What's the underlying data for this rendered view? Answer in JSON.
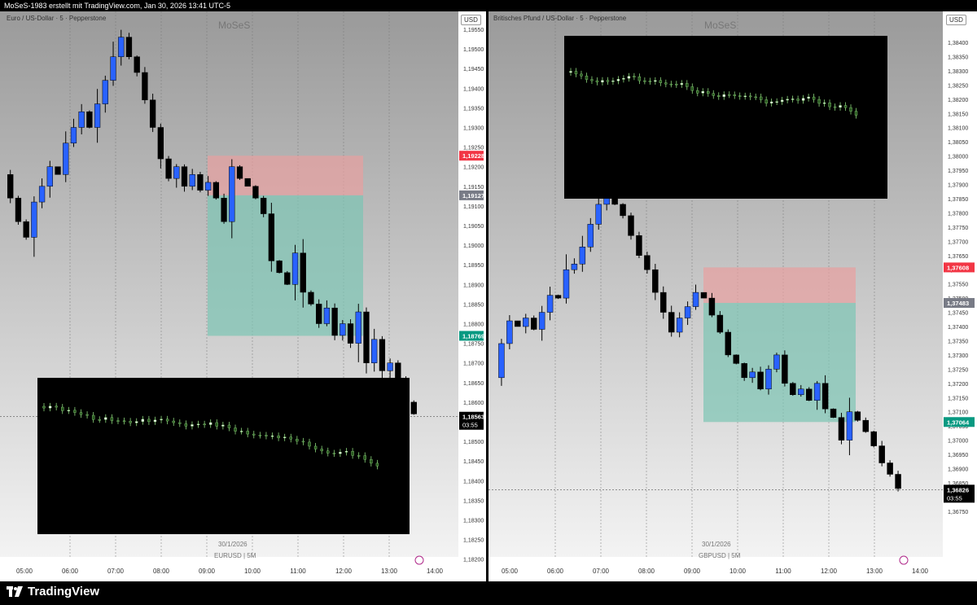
{
  "header": {
    "title": "MoSeS-1983 erstellt mit TradingView.com, Jan 30, 2026 13:41 UTC-5"
  },
  "footer": {
    "brand": "TradingView"
  },
  "colors": {
    "up": "#2962ff",
    "down": "#000000",
    "sl_zone": "#e8a0a0",
    "tp_zone": "#7cc4b4",
    "sl_label": "#f23645",
    "tp_label": "#089981"
  },
  "panels": [
    {
      "id": "eurusd",
      "symbol_title": "Euro / US-Dollar · 5 · Pepperstone",
      "watermark": "MoSeS",
      "currency": "USD",
      "date_label": "30/1/2026",
      "symbol_label": "EURUSD | 5M",
      "chart_data": {
        "type": "candlestick",
        "x_ticks": [
          "05:00",
          "06:00",
          "07:00",
          "08:00",
          "09:00",
          "10:00",
          "11:00",
          "12:00",
          "13:00",
          "14:00"
        ],
        "y_ticks": [
          "1,19550",
          "1,19500",
          "1,19450",
          "1,19400",
          "1,19350",
          "1,19300",
          "1,19250",
          "1,19200",
          "1,19150",
          "1,19100",
          "1,19050",
          "1,19000",
          "1,18950",
          "1,18900",
          "1,18850",
          "1,18800",
          "1,18750",
          "1,18700",
          "1,18650",
          "1,18600",
          "1,18550",
          "1,18500",
          "1,18450",
          "1,18400",
          "1,18350",
          "1,18300",
          "1,18250",
          "1,18200"
        ],
        "ylim": [
          1.18175,
          1.19575
        ],
        "price_labels": {
          "stop_loss": "1,19228",
          "entry": "1,19127",
          "take_profit": "1,18769",
          "last": "1,18563",
          "countdown": "03:55"
        },
        "path": [
          1.1918,
          1.1912,
          1.1906,
          1.1902,
          1.1911,
          1.1915,
          1.192,
          1.1918,
          1.1926,
          1.193,
          1.1934,
          1.193,
          1.1936,
          1.1942,
          1.1948,
          1.1953,
          1.1948,
          1.1944,
          1.1937,
          1.193,
          1.1922,
          1.1917,
          1.192,
          1.1915,
          1.1918,
          1.1914,
          1.1916,
          1.1912,
          1.1906,
          1.192,
          1.1917,
          1.1915,
          1.1912,
          1.1908,
          1.1896,
          1.1893,
          1.189,
          1.1898,
          1.1888,
          1.1885,
          1.188,
          1.1884,
          1.1877,
          1.188,
          1.1875,
          1.1883,
          1.187,
          1.1876,
          1.1868,
          1.187,
          1.1866,
          1.186,
          1.1857
        ]
      }
    },
    {
      "id": "gbpusd",
      "symbol_title": "Britisches Pfund / US-Dollar · 5 · Pepperstone",
      "watermark": "MoSeS",
      "currency": "USD",
      "date_label": "30/1/2026",
      "symbol_label": "GBPUSD | 5M",
      "chart_data": {
        "type": "candlestick",
        "x_ticks": [
          "05:00",
          "06:00",
          "07:00",
          "08:00",
          "09:00",
          "10:00",
          "11:00",
          "12:00",
          "13:00",
          "14:00"
        ],
        "y_ticks": [
          "1,38400",
          "1,38350",
          "1,38300",
          "1,38250",
          "1,38200",
          "1,38150",
          "1,38100",
          "1,38050",
          "1,38000",
          "1,37950",
          "1,37900",
          "1,37850",
          "1,37800",
          "1,37750",
          "1,37700",
          "1,37650",
          "1,37600",
          "1,37550",
          "1,37500",
          "1,37450",
          "1,37400",
          "1,37350",
          "1,37300",
          "1,37250",
          "1,37200",
          "1,37150",
          "1,37100",
          "1,37050",
          "1,37000",
          "1,36950",
          "1,36900",
          "1,36850",
          "1,36800",
          "1,36750"
        ],
        "ylim": [
          1.3673,
          1.3843
        ],
        "price_labels": {
          "stop_loss": "1,37608",
          "entry": "1,37483",
          "take_profit": "1,37064",
          "last": "1,36826",
          "countdown": "03:55"
        },
        "path": [
          1.3722,
          1.3734,
          1.3742,
          1.374,
          1.3743,
          1.3739,
          1.3745,
          1.3751,
          1.375,
          1.376,
          1.3762,
          1.3768,
          1.3776,
          1.3783,
          1.3786,
          1.3783,
          1.3779,
          1.3772,
          1.3765,
          1.376,
          1.3752,
          1.3745,
          1.3738,
          1.3743,
          1.3747,
          1.3752,
          1.375,
          1.3744,
          1.3738,
          1.373,
          1.3727,
          1.3722,
          1.3724,
          1.3718,
          1.3725,
          1.373,
          1.372,
          1.3716,
          1.3718,
          1.3714,
          1.372,
          1.3711,
          1.3708,
          1.37,
          1.371,
          1.3707,
          1.3703,
          1.3698,
          1.3692,
          1.3688,
          1.3683
        ]
      }
    }
  ]
}
